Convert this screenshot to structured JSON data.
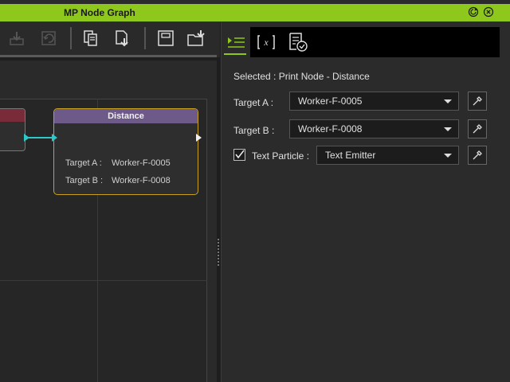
{
  "window": {
    "title": "MP Node Graph"
  },
  "colors": {
    "accent": "#8ec81c",
    "node_header": "#6d5a88",
    "node_border": "#c8a11f",
    "link": "#2ec8c8"
  },
  "toolbar": {
    "buttons": [
      "download-icon",
      "undo-icon",
      "copy-icon",
      "export-icon",
      "save-icon",
      "open-folder-icon"
    ]
  },
  "graph": {
    "node": {
      "title": "Distance",
      "rows": [
        {
          "label": "Target A :",
          "value": "Worker-F-0005"
        },
        {
          "label": "Target B :",
          "value": "Worker-F-0008"
        }
      ]
    }
  },
  "panel": {
    "tabs": [
      "properties-icon",
      "variable-icon",
      "checklist-icon"
    ],
    "selected": "Selected : Print Node - Distance",
    "target_a": {
      "label": "Target A :",
      "value": "Worker-F-0005"
    },
    "target_b": {
      "label": "Target B :",
      "value": "Worker-F-0008"
    },
    "text_particle": {
      "label": "Text Particle :",
      "value": "Text Emitter",
      "checked": true
    }
  }
}
